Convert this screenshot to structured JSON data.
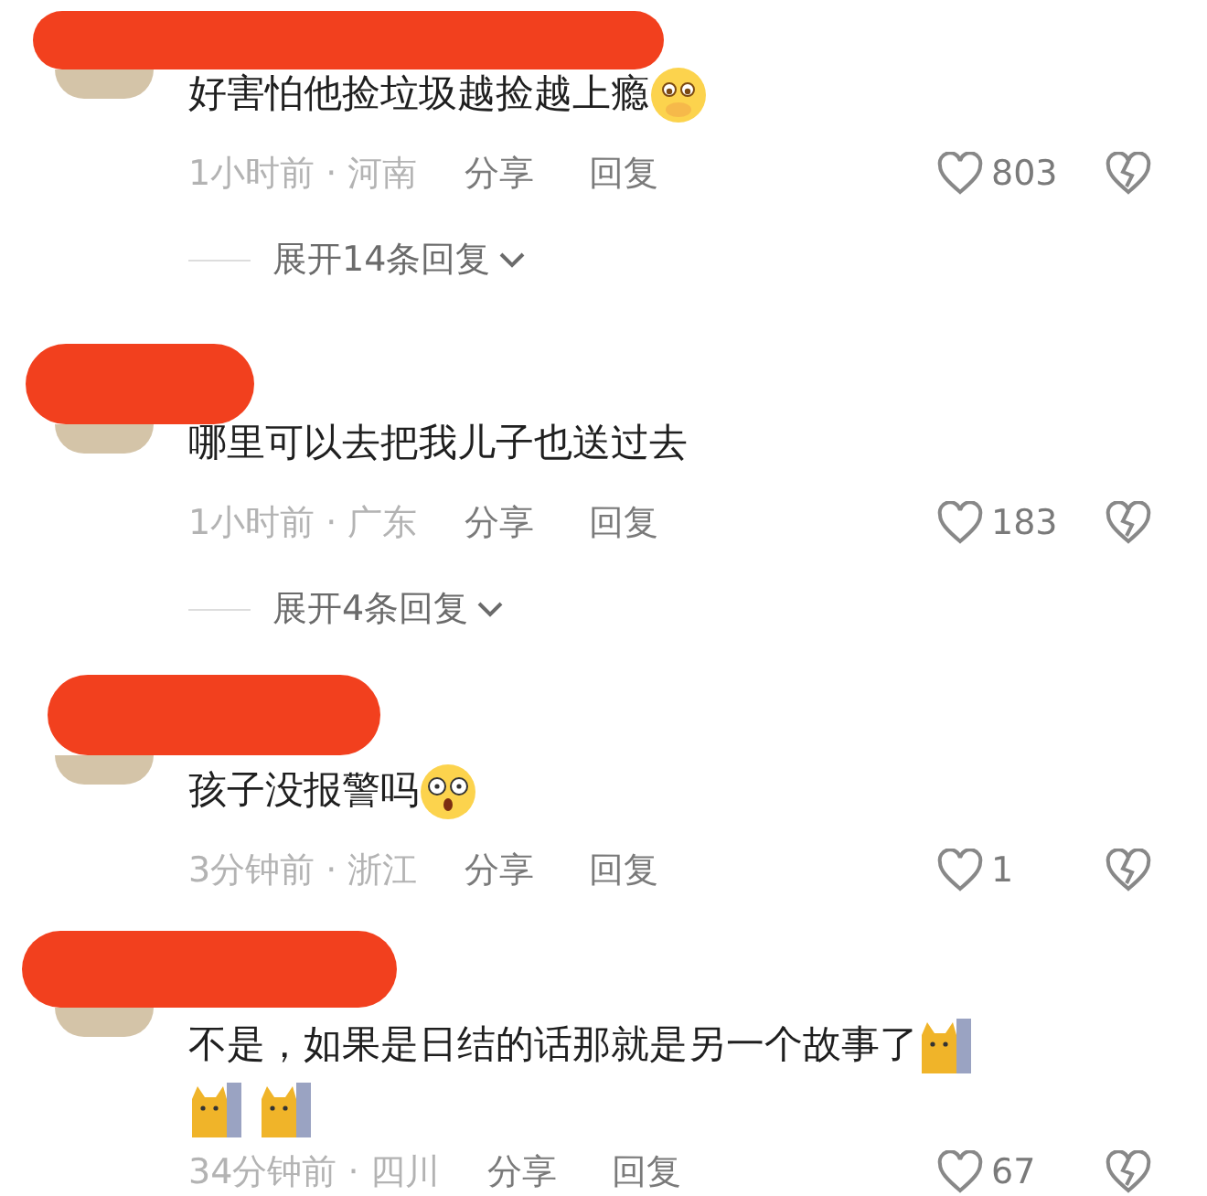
{
  "comments": [
    {
      "text": "好害怕他捡垃圾越捡越上瘾",
      "stickers": [
        {
          "kind": "face"
        }
      ],
      "time_location": "1小时前 · 河南",
      "share": "分享",
      "reply": "回复",
      "likes": "803",
      "expand": "展开14条回复"
    },
    {
      "text": "哪里可以去把我儿子也送过去",
      "time_location": "1小时前 · 广东",
      "share": "分享",
      "reply": "回复",
      "likes": "183",
      "expand": "展开4条回复"
    },
    {
      "text": "孩子没报警吗",
      "stickers": [
        {
          "kind": "shocked"
        }
      ],
      "time_location": "3分钟前 · 浙江",
      "share": "分享",
      "reply": "回复",
      "likes": "1"
    },
    {
      "text": "不是，如果是日结的话那就是另一个故事了",
      "stickers": [
        {
          "kind": "cat"
        }
      ],
      "extra_stickers": [
        {
          "kind": "cat"
        },
        {
          "kind": "cat"
        }
      ],
      "time_location": "34分钟前 · 四川",
      "share": "分享",
      "reply": "回复",
      "likes": "67"
    }
  ]
}
